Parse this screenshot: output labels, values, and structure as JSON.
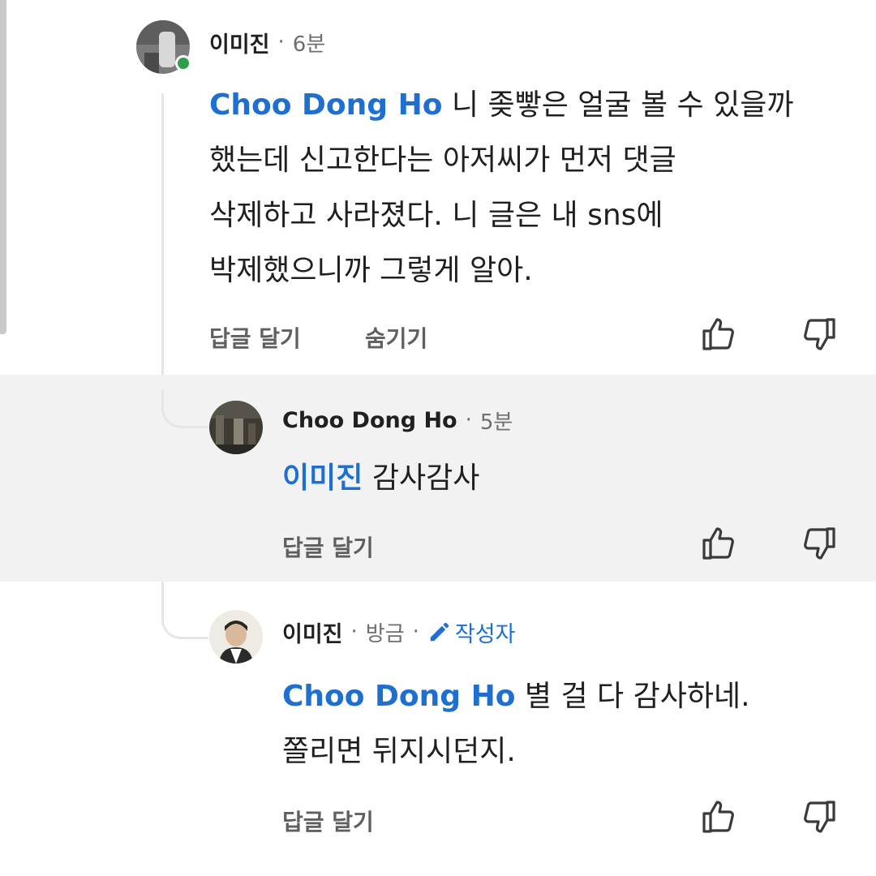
{
  "comments": [
    {
      "author": "이미진",
      "time": "6분",
      "mention": "Choo Dong Ho",
      "lines": [
        "니 좆빻은 얼굴 볼 수 있을까",
        "했는데 신고한다는 아저씨가 먼저 댓글",
        "삭제하고 사라졌다. 니 글은 내 sns에",
        "박제했으니까 그렇게 알아."
      ],
      "actions": {
        "reply": "답글 달기",
        "hide": "숨기기"
      }
    },
    {
      "author": "Choo Dong Ho",
      "time": "5분",
      "mention": "이미진",
      "lines": [
        "감사감사"
      ],
      "actions": {
        "reply": "답글 달기"
      }
    },
    {
      "author": "이미진",
      "time": "방금",
      "badge": "작성자",
      "mention": "Choo Dong Ho",
      "lines": [
        "별 걸 다 감사하네.",
        "쫄리면 뒤지시던지."
      ],
      "actions": {
        "reply": "답글 달기"
      }
    }
  ],
  "separator": "·",
  "icons": {
    "like": "thumbs-up-icon",
    "dislike": "thumbs-down-icon",
    "badge": "pencil-icon"
  },
  "colors": {
    "mention": "#1e6fd0",
    "highlight": "#f2f2f2",
    "online": "#2e9e48"
  }
}
